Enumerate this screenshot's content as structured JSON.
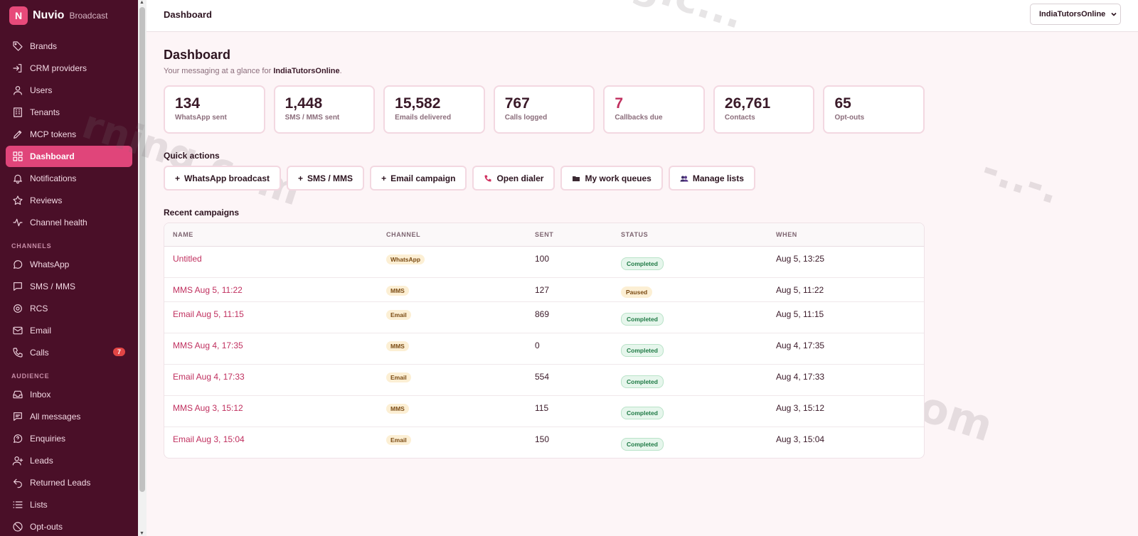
{
  "sidebar": {
    "brand": {
      "logo_letter": "N",
      "name": "Nuvio",
      "sub": "Broadcast"
    },
    "items": [
      {
        "label": "Brands",
        "icon": "tag-icon"
      },
      {
        "label": "CRM providers",
        "icon": "sign-in-icon"
      },
      {
        "label": "Users",
        "icon": "user-icon"
      },
      {
        "label": "Tenants",
        "icon": "building-icon"
      },
      {
        "label": "MCP tokens",
        "icon": "pen-icon"
      },
      {
        "label": "Dashboard",
        "icon": "grid-icon",
        "active": true
      },
      {
        "label": "Notifications",
        "icon": "bell-icon"
      },
      {
        "label": "Reviews",
        "icon": "star-icon"
      },
      {
        "label": "Channel health",
        "icon": "pulse-icon"
      }
    ],
    "channels_label": "CHANNELS",
    "channels": [
      {
        "label": "WhatsApp",
        "icon": "chat-bubble-icon"
      },
      {
        "label": "SMS / MMS",
        "icon": "message-square-icon"
      },
      {
        "label": "RCS",
        "icon": "rcs-icon"
      },
      {
        "label": "Email",
        "icon": "mail-icon"
      },
      {
        "label": "Calls",
        "icon": "phone-icon",
        "badge": "7"
      }
    ],
    "audience_label": "AUDIENCE",
    "audience": [
      {
        "label": "Inbox",
        "icon": "inbox-icon"
      },
      {
        "label": "All messages",
        "icon": "messages-icon"
      },
      {
        "label": "Enquiries",
        "icon": "help-bubble-icon"
      },
      {
        "label": "Leads",
        "icon": "user-plus-icon"
      },
      {
        "label": "Returned Leads",
        "icon": "return-icon"
      },
      {
        "label": "Lists",
        "icon": "list-icon"
      },
      {
        "label": "Opt-outs",
        "icon": "ban-icon"
      }
    ]
  },
  "topbar": {
    "title": "Dashboard",
    "tenant": "IndiaTutorsOnline"
  },
  "page": {
    "title": "Dashboard",
    "subtitle_prefix": "Your messaging at a glance for ",
    "subtitle_tenant": "IndiaTutorsOnline",
    "subtitle_suffix": "."
  },
  "stats": [
    {
      "value": "134",
      "label": "WhatsApp sent"
    },
    {
      "value": "1,448",
      "label": "SMS / MMS sent"
    },
    {
      "value": "15,582",
      "label": "Emails delivered"
    },
    {
      "value": "767",
      "label": "Calls logged"
    },
    {
      "value": "7",
      "label": "Callbacks due",
      "accent": true
    },
    {
      "value": "26,761",
      "label": "Contacts"
    },
    {
      "value": "65",
      "label": "Opt-outs"
    }
  ],
  "quick_actions": {
    "title": "Quick actions",
    "items": [
      {
        "label": "WhatsApp broadcast",
        "icon": "plus-icon"
      },
      {
        "label": "SMS / MMS",
        "icon": "plus-icon"
      },
      {
        "label": "Email campaign",
        "icon": "plus-icon"
      },
      {
        "label": "Open dialer",
        "icon": "phone-icon"
      },
      {
        "label": "My work queues",
        "icon": "folder-icon"
      },
      {
        "label": "Manage lists",
        "icon": "people-icon"
      }
    ]
  },
  "recent": {
    "title": "Recent campaigns",
    "headers": [
      "NAME",
      "CHANNEL",
      "SENT",
      "STATUS",
      "WHEN"
    ],
    "rows": [
      {
        "name": "Untitled",
        "channel": "WhatsApp",
        "sent": "100",
        "status": "Completed",
        "when": "Aug 5, 13:25"
      },
      {
        "name": "MMS Aug 5, 11:22",
        "channel": "MMS",
        "sent": "127",
        "status": "Paused",
        "when": "Aug 5, 11:22"
      },
      {
        "name": "Email Aug 5, 11:15",
        "channel": "Email",
        "sent": "869",
        "status": "Completed",
        "when": "Aug 5, 11:15"
      },
      {
        "name": "MMS Aug 4, 17:35",
        "channel": "MMS",
        "sent": "0",
        "status": "Completed",
        "when": "Aug 4, 17:35"
      },
      {
        "name": "Email Aug 4, 17:33",
        "channel": "Email",
        "sent": "554",
        "status": "Completed",
        "when": "Aug 4, 17:33"
      },
      {
        "name": "MMS Aug 3, 15:12",
        "channel": "MMS",
        "sent": "115",
        "status": "Completed",
        "when": "Aug 3, 15:12"
      },
      {
        "name": "Email Aug 3, 15:04",
        "channel": "Email",
        "sent": "150",
        "status": "Completed",
        "when": "Aug 3, 15:04"
      }
    ]
  },
  "watermarks": [
    "nuviolearning.com",
    "rning.com"
  ]
}
